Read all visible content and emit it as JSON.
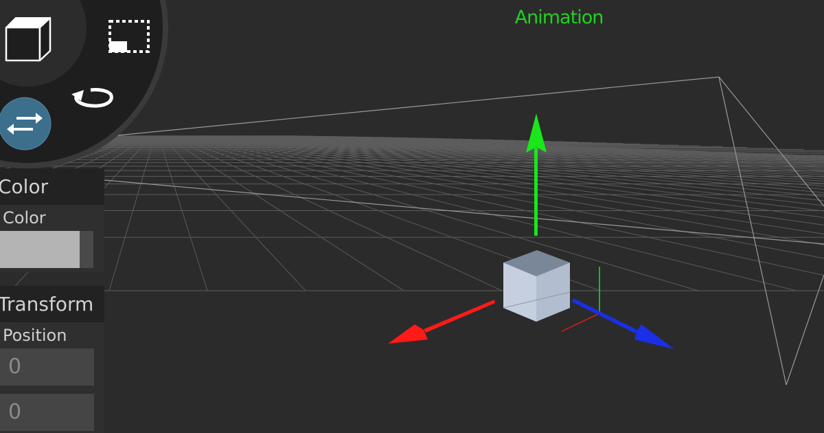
{
  "viewport": {
    "mode_title": "Animation",
    "mode_title_color": "#1fd21f",
    "axis_colors": {
      "x": "#ff1a1a",
      "y": "#1ae61a",
      "z": "#1a2fe6"
    },
    "cube_color": "#b8c2d4",
    "grid_color": "#5c5c5c"
  },
  "toolbar": {
    "icons": [
      "cube-icon",
      "box-select-icon",
      "move-arrows-icon",
      "rotate-icon"
    ],
    "active_tool": "move",
    "active_color": "#3b6f8c"
  },
  "color_panel": {
    "header": "Color",
    "field_label": "Color",
    "swatch_color": "#b4b4b4"
  },
  "transform_panel": {
    "header": "Transform",
    "field_label": "Position",
    "values": [
      "0",
      "0"
    ]
  }
}
